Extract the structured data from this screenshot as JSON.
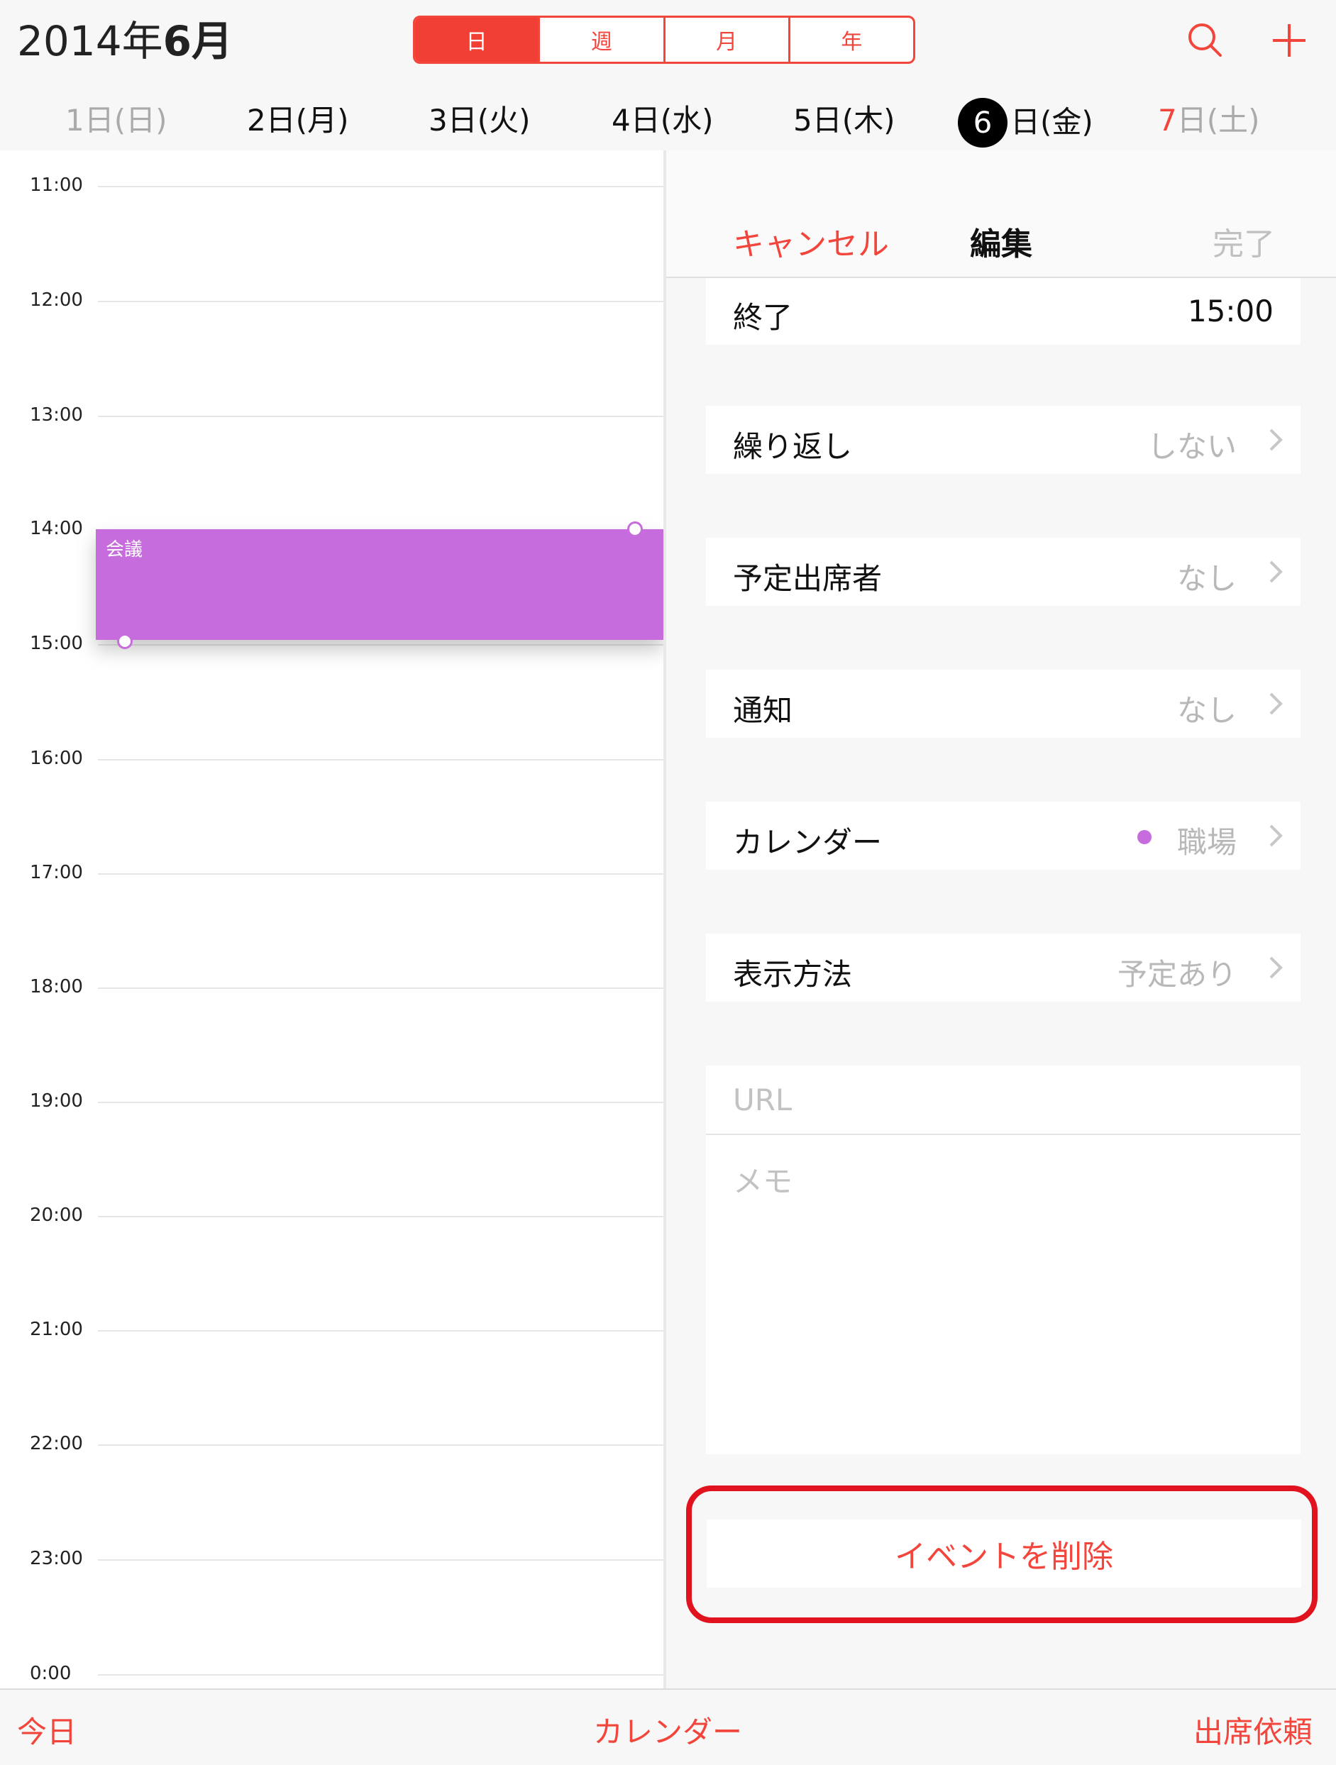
{
  "header": {
    "year": "2014年",
    "month": "6月",
    "segments": [
      "日",
      "週",
      "月",
      "年"
    ],
    "active_segment": 0,
    "icons": {
      "search": "search-icon",
      "add": "plus-icon"
    },
    "accent_color": "#f2463c"
  },
  "days": [
    {
      "label": "1日(日)"
    },
    {
      "label": "2日(月)"
    },
    {
      "label": "3日(火)"
    },
    {
      "label": "4日(水)"
    },
    {
      "label": "5日(木)"
    },
    {
      "num": "6",
      "rest": "日(金)"
    },
    {
      "num": "7",
      "rest": "日(土)"
    }
  ],
  "timeline": {
    "hours": [
      "11:00",
      "12:00",
      "13:00",
      "14:00",
      "15:00",
      "16:00",
      "17:00",
      "18:00",
      "19:00",
      "20:00",
      "21:00",
      "22:00",
      "23:00",
      "0:00"
    ],
    "event": {
      "title": "会議",
      "color": "#c66cdd"
    }
  },
  "panel": {
    "nav": {
      "cancel": "キャンセル",
      "title": "編集",
      "done": "完了"
    },
    "rows": {
      "end": {
        "label": "終了",
        "value": "15:00"
      },
      "repeat": {
        "label": "繰り返し",
        "value": "しない"
      },
      "invitees": {
        "label": "予定出席者",
        "value": "なし"
      },
      "alert": {
        "label": "通知",
        "value": "なし"
      },
      "calendar": {
        "label": "カレンダー",
        "value": "職場",
        "dot_color": "#c66cdd"
      },
      "show_as": {
        "label": "表示方法",
        "value": "予定あり"
      }
    },
    "url_placeholder": "URL",
    "notes_placeholder": "メモ",
    "delete_label": "イベントを削除"
  },
  "toolbar": {
    "today": "今日",
    "calendars": "カレンダー",
    "inbox": "出席依頼"
  }
}
